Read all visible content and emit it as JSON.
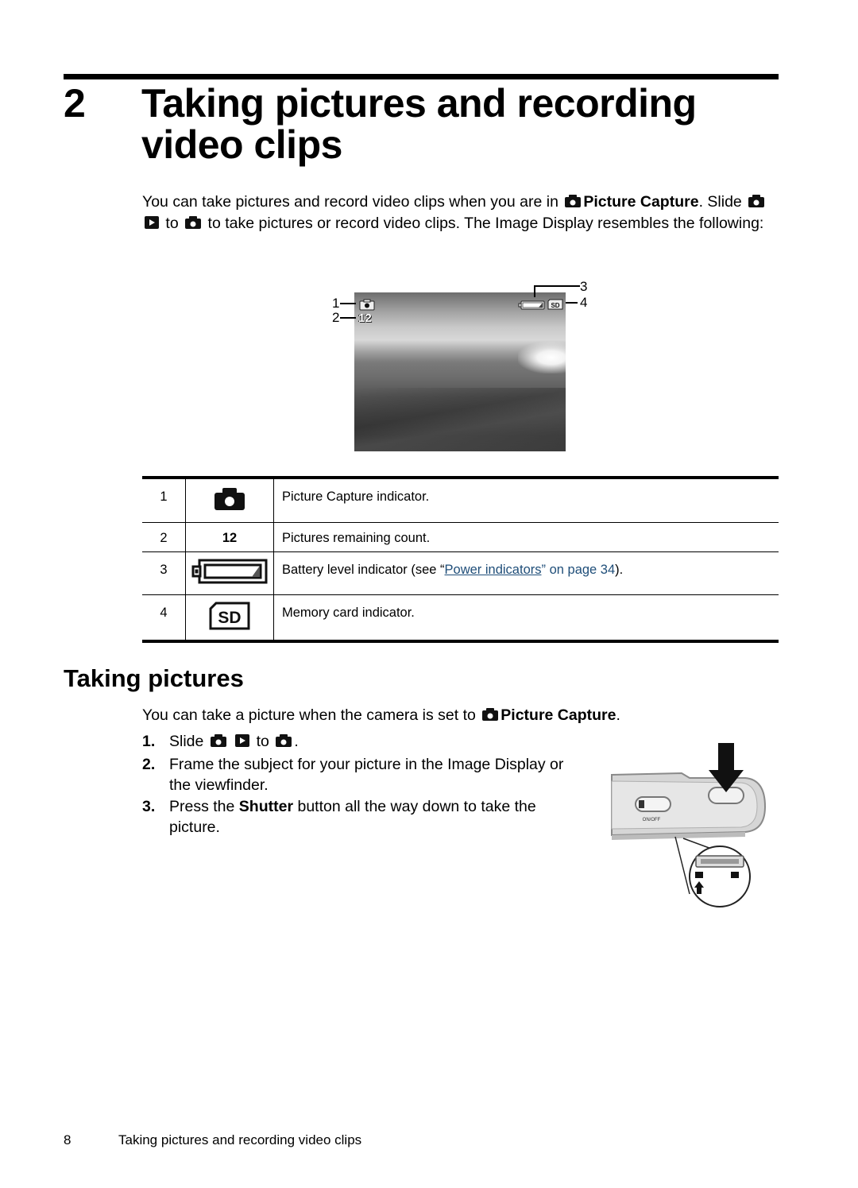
{
  "chapter": {
    "number": "2",
    "title": "Taking pictures and recording video clips"
  },
  "intro": {
    "text_1": "You can take pictures and record video clips when you are in",
    "mode_label": "Picture Capture",
    "text_2": ". Slide",
    "text_3": "to",
    "text_4": "to take pictures or record video clips. The Image Display resembles the following:",
    "icons": [
      "camera-icon",
      "camera-icon",
      "playback-icon",
      "camera-icon"
    ]
  },
  "display_figure": {
    "overlay_count": "12",
    "callouts": [
      "1",
      "2",
      "3",
      "4"
    ],
    "overlay_icons": [
      "camera-icon",
      "battery-icon",
      "sd-card-icon"
    ]
  },
  "legend_table": {
    "rows": [
      {
        "number": "1",
        "icon": "camera-icon",
        "description": "Picture Capture indicator."
      },
      {
        "number": "2",
        "icon_text": "12",
        "description": "Pictures remaining count."
      },
      {
        "number": "3",
        "icon": "battery-icon",
        "description_before": "Battery level indicator (see “",
        "link_text": "Power indicators",
        "link_after": "” on page 34",
        "description_after": ")."
      },
      {
        "number": "4",
        "icon": "sd-card-icon",
        "description": "Memory card indicator."
      }
    ]
  },
  "section": {
    "title": "Taking pictures",
    "lead_text": "You can take a picture when the camera is set to",
    "lead_mode": "Picture Capture",
    "lead_end": ".",
    "steps": [
      {
        "number": "1.",
        "text_a": "Slide",
        "text_b": "to",
        "text_c": "."
      },
      {
        "number": "2.",
        "text": "Frame the subject for your picture in the Image Display or the viewfinder."
      },
      {
        "number": "3.",
        "text_a": "Press the",
        "bold": "Shutter",
        "text_b": "button all the way down to take the picture."
      }
    ]
  },
  "camera_figure": {
    "switch_label": "ON/OFF"
  },
  "footer": {
    "page_number": "8",
    "title": "Taking pictures and recording video clips"
  },
  "colors": {
    "link": "#1f4e79",
    "text": "#000000"
  }
}
